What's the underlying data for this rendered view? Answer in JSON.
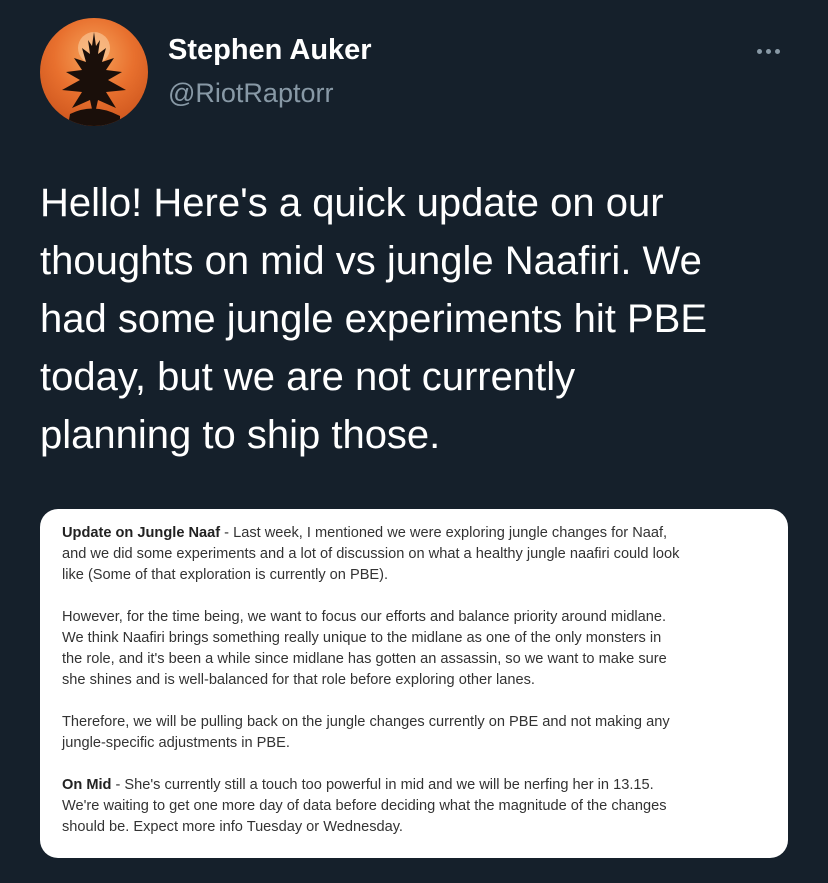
{
  "author": {
    "display_name": "Stephen Auker",
    "handle": "@RiotRaptorr",
    "avatar_icon": "phoenix-silhouette-avatar",
    "more_icon": "ellipsis-icon"
  },
  "tweet": {
    "lines": [
      "Hello! Here's a quick update on our",
      "thoughts on mid vs jungle Naafiri. We",
      "had some jungle experiments hit PBE",
      "today, but we are not currently",
      "planning to ship those."
    ]
  },
  "image": {
    "p1": {
      "bold": "Update on Jungle Naaf",
      "lines": [
        " - Last week, I mentioned we were exploring jungle changes for Naaf,",
        "and we did some experiments and a lot of discussion on what a healthy jungle naafiri could look",
        "like (Some of that exploration is currently on PBE)."
      ]
    },
    "p2": {
      "lines": [
        "However, for the time being, we want to focus our efforts and balance priority around midlane.",
        "We think Naafiri brings something really unique to the midlane as one of the only monsters in",
        "the role, and it's been a while since midlane has gotten an assassin, so we want to make sure",
        "she shines and is well-balanced for that role before exploring other lanes."
      ]
    },
    "p3": {
      "lines": [
        "Therefore, we will be pulling back on the jungle changes currently on PBE and not making any",
        "jungle-specific adjustments in PBE."
      ]
    },
    "p4": {
      "bold": "On Mid",
      "lines": [
        " - She's currently still a touch too powerful in mid and we will be nerfing her in 13.15.",
        "We're waiting to get one more day of data before deciding what the magnitude of the changes",
        "should be. Expect more info Tuesday or Wednesday."
      ]
    }
  },
  "colors": {
    "background": "#15202b",
    "secondary_text": "#8899a6",
    "avatar_orange": "#e8702e"
  }
}
